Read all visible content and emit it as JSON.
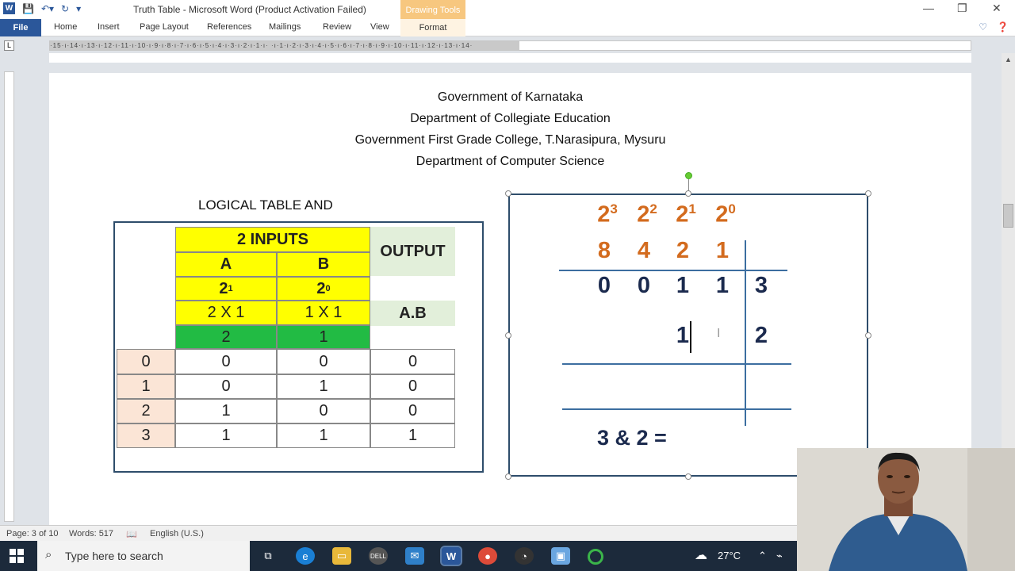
{
  "window": {
    "title": "Truth Table  -  Microsoft Word (Product Activation Failed)",
    "contextual_group": "Drawing Tools",
    "minimize": "—",
    "restore": "❐",
    "close": "✕"
  },
  "ribbon": {
    "file": "File",
    "tabs": [
      "Home",
      "Insert",
      "Page Layout",
      "References",
      "Mailings",
      "Review",
      "View"
    ],
    "format": "Format"
  },
  "ruler": {
    "marks": "·15·ı·14·ı·13·ı·12·ı·11·ı·10·ı·9·ı·8·ı·7·ı·6·ı·5·ı·4·ı·3·ı·2·ı·1·ı·  ·ı·1·ı·2·ı·3·ı·4·ı·5·ı·6·ı·7·ı·8·ı·9·ı·10·ı·11·ı·12·ı·13·ı·14·"
  },
  "document": {
    "heading_lines": [
      "Government of Karnataka",
      "Department of Collegiate Education",
      "Government First Grade College, T.Narasipura, Mysuru",
      "Department of Computer Science"
    ],
    "logic_table": {
      "title": "LOGICAL TABLE AND",
      "inputs_header": "2 INPUTS",
      "output_header": "OUTPUT",
      "col_a": "A",
      "col_b": "B",
      "pow_a_base": "2",
      "pow_a_exp": "1",
      "pow_b_base": "2",
      "pow_b_exp": "0",
      "mult_a": "2 X 1",
      "mult_b": "1 X 1",
      "expr": "A.B",
      "weight_a": "2",
      "weight_b": "1",
      "rows": [
        {
          "idx": "0",
          "a": "0",
          "b": "0",
          "out": "0"
        },
        {
          "idx": "1",
          "a": "0",
          "b": "1",
          "out": "0"
        },
        {
          "idx": "2",
          "a": "1",
          "b": "0",
          "out": "0"
        },
        {
          "idx": "3",
          "a": "1",
          "b": "1",
          "out": "1"
        }
      ]
    },
    "binary_box": {
      "powers": [
        {
          "base": "2",
          "exp": "3"
        },
        {
          "base": "2",
          "exp": "2"
        },
        {
          "base": "2",
          "exp": "1"
        },
        {
          "base": "2",
          "exp": "0"
        }
      ],
      "weights": [
        "8",
        "4",
        "2",
        "1"
      ],
      "row1_bits": [
        "0",
        "0",
        "1",
        "1"
      ],
      "row1_value": "3",
      "row2_bits": [
        "1"
      ],
      "row2_value": "2",
      "equation": "3 & 2 ="
    }
  },
  "status_bar": {
    "page": "Page: 3 of 10",
    "words": "Words: 517",
    "language": "English (U.S.)"
  },
  "taskbar": {
    "search_placeholder": "Type here to search",
    "temperature": "27°C"
  },
  "colors": {
    "word_blue": "#2b579a",
    "table_yellow": "#ffff00",
    "table_green": "#22bb44",
    "power_orange": "#d36b1e",
    "digit_navy": "#1b2a4e",
    "frame_blue": "#2e4d6b"
  }
}
